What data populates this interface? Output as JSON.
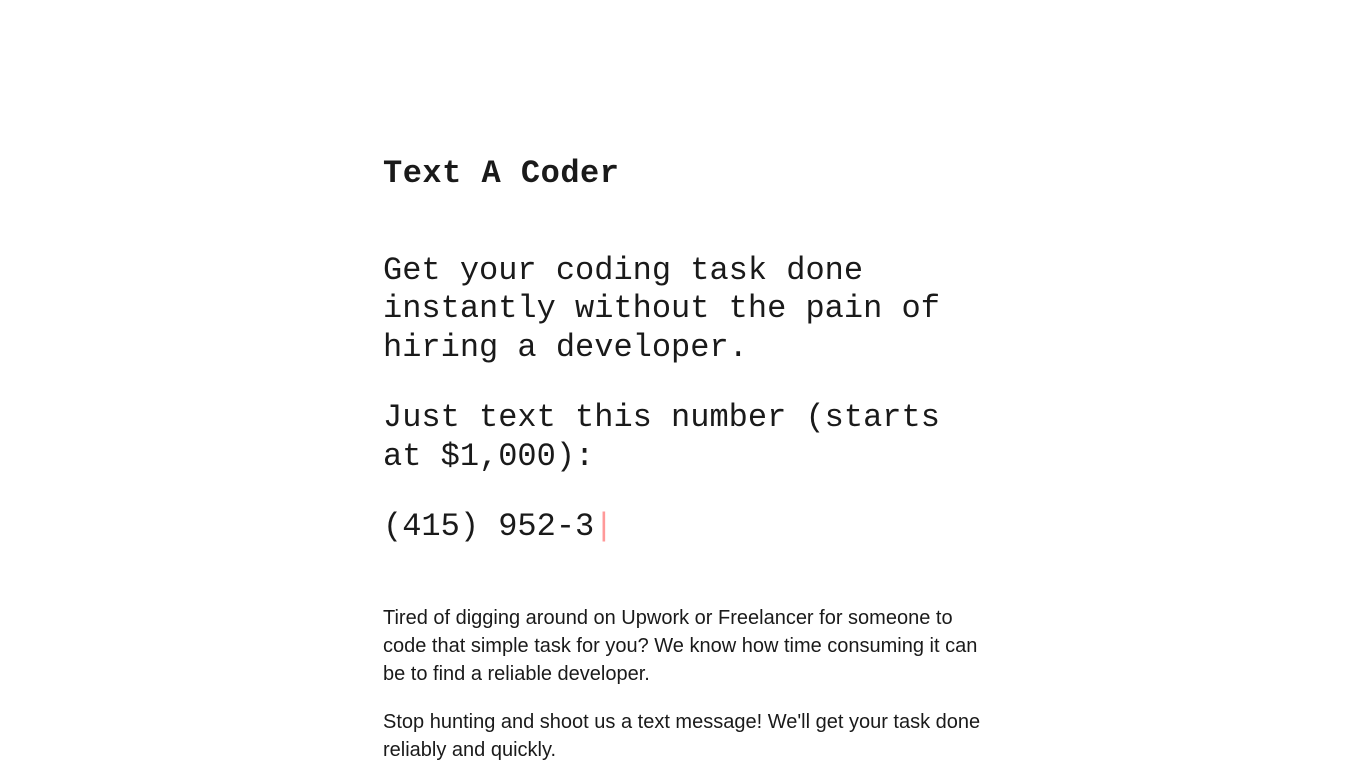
{
  "title": "Text A Coder",
  "headline": "Get your coding task done instantly without the pain of hiring a developer.",
  "subhead": "Just text this number (starts at $1,000):",
  "phone": "(415) 952-3",
  "paragraphs": [
    "Tired of digging around on Upwork or Freelancer for someone to code that simple task for you? We know how time consuming it can be to find a reliable developer.",
    "Stop hunting and shoot us a text message! We'll get your task done reliably and quickly."
  ]
}
